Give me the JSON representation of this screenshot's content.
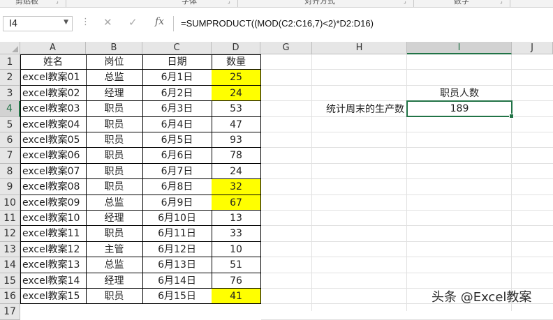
{
  "ribbon": {
    "groups": [
      {
        "label": "剪贴板"
      },
      {
        "label": "字体"
      },
      {
        "label": "对齐方式"
      },
      {
        "label": "数字"
      }
    ]
  },
  "formula_bar": {
    "name_box": "I4",
    "formula": "=SUMPRODUCT((MOD(C2:C16,7)<2)*D2:D16)"
  },
  "columns": [
    "A",
    "B",
    "C",
    "D",
    "G",
    "H",
    "I",
    "J"
  ],
  "selected_column": "I",
  "rows": [
    "1",
    "2",
    "3",
    "4",
    "5",
    "6",
    "7",
    "8",
    "9",
    "10",
    "11",
    "12",
    "13",
    "14",
    "15",
    "16",
    "17"
  ],
  "selected_row": "4",
  "table": {
    "headers": [
      "姓名",
      "岗位",
      "日期",
      "数量"
    ],
    "rows": [
      {
        "name": "excel教案01",
        "post": "总监",
        "date": "6月1日",
        "qty": "25",
        "hl": true
      },
      {
        "name": "excel教案02",
        "post": "经理",
        "date": "6月2日",
        "qty": "24",
        "hl": true
      },
      {
        "name": "excel教案03",
        "post": "职员",
        "date": "6月3日",
        "qty": "53",
        "hl": false
      },
      {
        "name": "excel教案04",
        "post": "职员",
        "date": "6月4日",
        "qty": "47",
        "hl": false
      },
      {
        "name": "excel教案05",
        "post": "职员",
        "date": "6月5日",
        "qty": "93",
        "hl": false
      },
      {
        "name": "excel教案06",
        "post": "职员",
        "date": "6月6日",
        "qty": "78",
        "hl": false
      },
      {
        "name": "excel教案07",
        "post": "职员",
        "date": "6月7日",
        "qty": "24",
        "hl": false
      },
      {
        "name": "excel教案08",
        "post": "职员",
        "date": "6月8日",
        "qty": "32",
        "hl": true
      },
      {
        "name": "excel教案09",
        "post": "总监",
        "date": "6月9日",
        "qty": "67",
        "hl": true
      },
      {
        "name": "excel教案10",
        "post": "经理",
        "date": "6月10日",
        "qty": "13",
        "hl": false
      },
      {
        "name": "excel教案11",
        "post": "职员",
        "date": "6月11日",
        "qty": "33",
        "hl": false
      },
      {
        "name": "excel教案12",
        "post": "主管",
        "date": "6月12日",
        "qty": "10",
        "hl": false
      },
      {
        "name": "excel教案13",
        "post": "总监",
        "date": "6月13日",
        "qty": "51",
        "hl": false
      },
      {
        "name": "excel教案14",
        "post": "经理",
        "date": "6月14日",
        "qty": "76",
        "hl": false
      },
      {
        "name": "excel教案15",
        "post": "职员",
        "date": "6月15日",
        "qty": "41",
        "hl": true
      }
    ]
  },
  "side": {
    "header_i3": "职员人数",
    "label_h4": "统计周末的生产数",
    "value_i4": "189"
  },
  "watermark": "头条 @Excel教案",
  "colors": {
    "highlight": "#ffff00",
    "accent": "#217346"
  }
}
